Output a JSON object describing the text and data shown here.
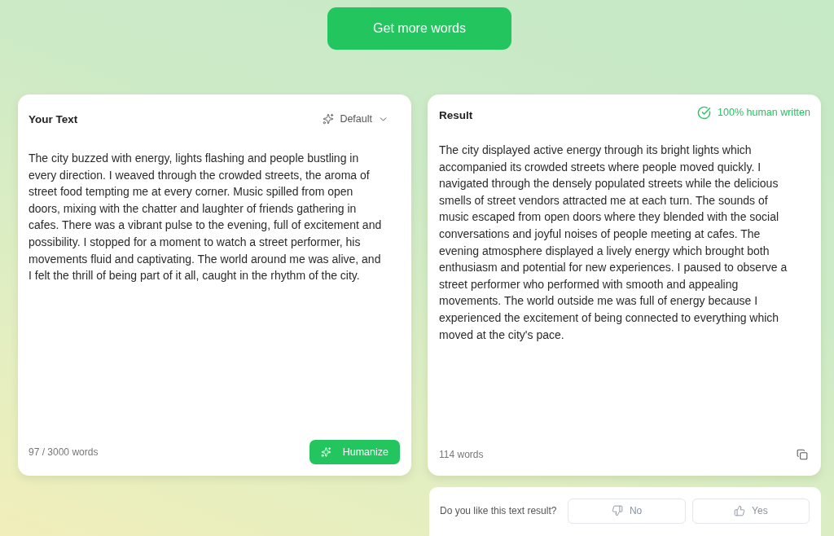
{
  "top_button": "Get more words",
  "input_panel": {
    "title": "Your Text",
    "mode": {
      "label": "Default"
    },
    "text": "The city buzzed with energy, lights flashing and people bustling in every direction. I weaved through the crowded streets, the aroma of street food tempting me at every corner. Music spilled from open doors, mixing with the chatter and laughter of friends gathering in cafes. There was a vibrant pulse to the evening, full of excitement and possibility. I stopped for a moment to watch a street performer, his movements fluid and captivating. The world around me was alive, and I felt the thrill of being part of it all, caught in the rhythm of the city.",
    "word_count": "97 / 3000 words",
    "action_button": "Humanize"
  },
  "result_panel": {
    "title": "Result",
    "badge": "100% human written",
    "text": "The city displayed active energy through its bright lights which accompanied its crowded streets where people moved quickly. I navigated through the densely populated streets while the delicious smells of street vendors attracted me at each turn. The sounds of music escaped from open doors where they blended with the social conversations and joyful noises of people meeting at cafes. The evening atmosphere displayed a lively energy which brought both enthusiasm and potential for new experiences. I paused to observe a street performer who performed with smooth and appealing movements. The world outside me was full of energy because I experienced the excitement of being connected to everything which moved at the city's pace.",
    "word_count": "114 words"
  },
  "feedback": {
    "question": "Do you like this text result?",
    "options": [
      {
        "label": "No",
        "kind": "dislike"
      },
      {
        "label": "Yes",
        "kind": "like"
      }
    ]
  }
}
